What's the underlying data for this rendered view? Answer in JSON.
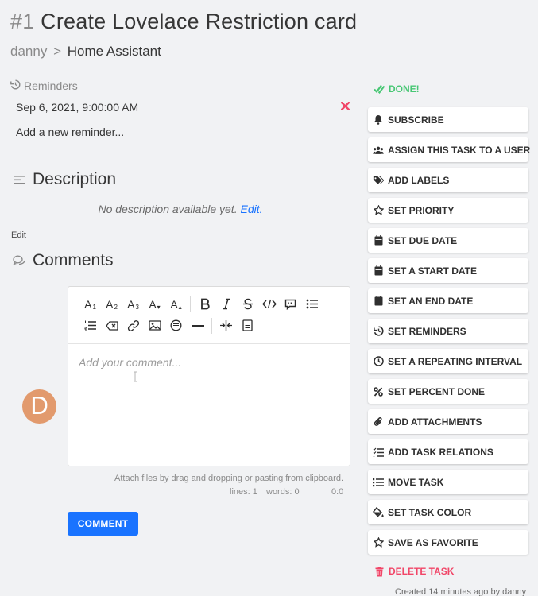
{
  "task": {
    "number": "#1",
    "title": "Create Lovelace Restriction card",
    "project_parent": "danny",
    "breadcrumb_sep": ">",
    "project": "Home Assistant"
  },
  "reminders": {
    "heading": "Reminders",
    "items": [
      {
        "date": "Sep 6, 2021, 9:00:00 AM"
      }
    ],
    "add_placeholder": "Add a new reminder..."
  },
  "description": {
    "heading": "Description",
    "empty_text": "No description available yet.",
    "edit_inline": "Edit.",
    "edit_label": "Edit"
  },
  "comments": {
    "heading": "Comments",
    "avatar_letter": "D",
    "placeholder": "Add your comment...",
    "attach_hint": "Attach files by drag and dropping or pasting from clipboard.",
    "lines": "lines: 1",
    "words": "words: 0",
    "cursor": "0:0",
    "submit_label": "COMMENT",
    "toolbar": {
      "h1": "A",
      "h1_sub": "1",
      "h2": "A",
      "h2_sub": "2",
      "h3": "A",
      "h3_sub": "3",
      "smaller": "A",
      "smaller_sub": "▾",
      "bigger": "A",
      "bigger_sub": "▴"
    }
  },
  "actions": {
    "done": "DONE!",
    "items": [
      {
        "label": "SUBSCRIBE",
        "icon": "bell-icon"
      },
      {
        "label": "ASSIGN THIS TASK TO A USER",
        "icon": "users-icon"
      },
      {
        "label": "ADD LABELS",
        "icon": "tags-icon"
      },
      {
        "label": "SET PRIORITY",
        "icon": "star-icon"
      },
      {
        "label": "SET DUE DATE",
        "icon": "calendar-icon"
      },
      {
        "label": "SET A START DATE",
        "icon": "calendar-icon"
      },
      {
        "label": "SET AN END DATE",
        "icon": "calendar-icon"
      },
      {
        "label": "SET REMINDERS",
        "icon": "history-icon"
      },
      {
        "label": "SET A REPEATING INTERVAL",
        "icon": "clock-icon"
      },
      {
        "label": "SET PERCENT DONE",
        "icon": "percent-icon"
      },
      {
        "label": "ADD ATTACHMENTS",
        "icon": "paperclip-icon"
      },
      {
        "label": "ADD TASK RELATIONS",
        "icon": "tasks-icon"
      },
      {
        "label": "MOVE TASK",
        "icon": "list-icon"
      },
      {
        "label": "SET TASK COLOR",
        "icon": "fill-drip-icon"
      },
      {
        "label": "SAVE AS FAVORITE",
        "icon": "star-icon"
      }
    ],
    "delete": "DELETE TASK"
  },
  "footer": {
    "created": "Created 14 minutes ago by danny"
  },
  "colors": {
    "accent": "#1973ff",
    "success": "#48c774",
    "danger": "#f14668",
    "avatar": "#e29a6d"
  }
}
